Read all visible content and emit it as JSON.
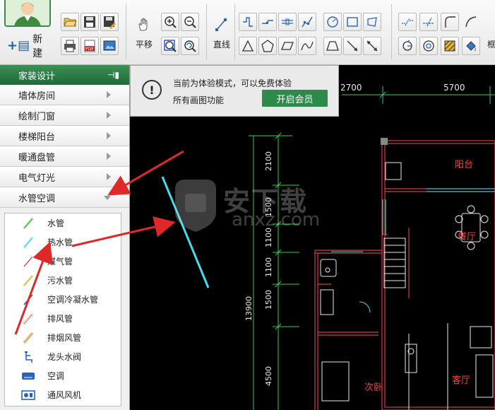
{
  "toolbar": {
    "new_label": "新建",
    "pan_label": "平移",
    "line_label": "直线",
    "side_char": "框"
  },
  "panel": {
    "title": "家装设计",
    "categories": [
      {
        "label": "墙体房间"
      },
      {
        "label": "绘制门窗"
      },
      {
        "label": "楼梯阳台"
      },
      {
        "label": "暖通盘管"
      },
      {
        "label": "电气灯光"
      },
      {
        "label": "水管空调"
      }
    ],
    "pipe_items": [
      {
        "label": "水管",
        "color": "#3ec83e"
      },
      {
        "label": "热水管",
        "color": "#3ee0e0"
      },
      {
        "label": "煤气管",
        "color": "#e03030"
      },
      {
        "label": "污水管",
        "color": "#d8c848"
      },
      {
        "label": "空调冷凝水管",
        "color": "#3040d0"
      },
      {
        "label": "排风管",
        "color": "#e89060"
      },
      {
        "label": "排烟风管",
        "color": "#e8b070"
      },
      {
        "label": "龙头水阀"
      },
      {
        "label": "空调"
      },
      {
        "label": "通风风机"
      }
    ]
  },
  "popup": {
    "line1": "当前为体验模式，可以免费体验",
    "line2": "所有画图功能",
    "button": "开启会员"
  },
  "drawing": {
    "dim_top_1": "2700",
    "dim_top_2": "5700",
    "dim_total": "13900",
    "dims_left": [
      "2100",
      "1500",
      "1100",
      "1100",
      "1500",
      "4500"
    ],
    "room_balcony": "阳台",
    "room_dining": "餐厅",
    "room_living": "客厅",
    "room_bedroom": "次卧"
  },
  "watermark": {
    "cn": "安下载",
    "en": "anxz.com"
  },
  "colors": {
    "accent_green": "#2c8a4a",
    "wall_red": "#d04040",
    "dim_green": "#2fd24a",
    "hot_pipe_cyan": "#3ee0ee",
    "annotation_red": "#e02828"
  }
}
